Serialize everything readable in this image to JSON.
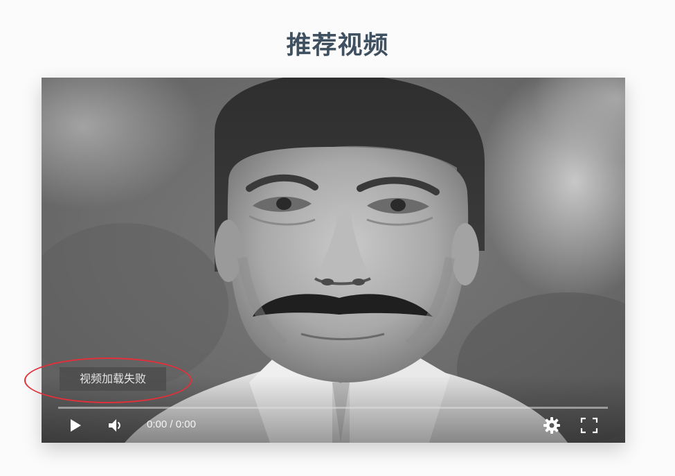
{
  "page": {
    "title": "推荐视频"
  },
  "player": {
    "error_message": "视频加载失败",
    "current_time": "0:00",
    "time_separator": "/",
    "duration": "0:00",
    "progress": 0,
    "icons": {
      "play": "play-icon",
      "volume": "volume-icon",
      "settings": "gear-icon",
      "fullscreen": "fullscreen-icon"
    }
  },
  "annotation": {
    "highlight_color": "#e2303a"
  },
  "colors": {
    "title": "#3f5060",
    "background": "#fbfbfc"
  }
}
